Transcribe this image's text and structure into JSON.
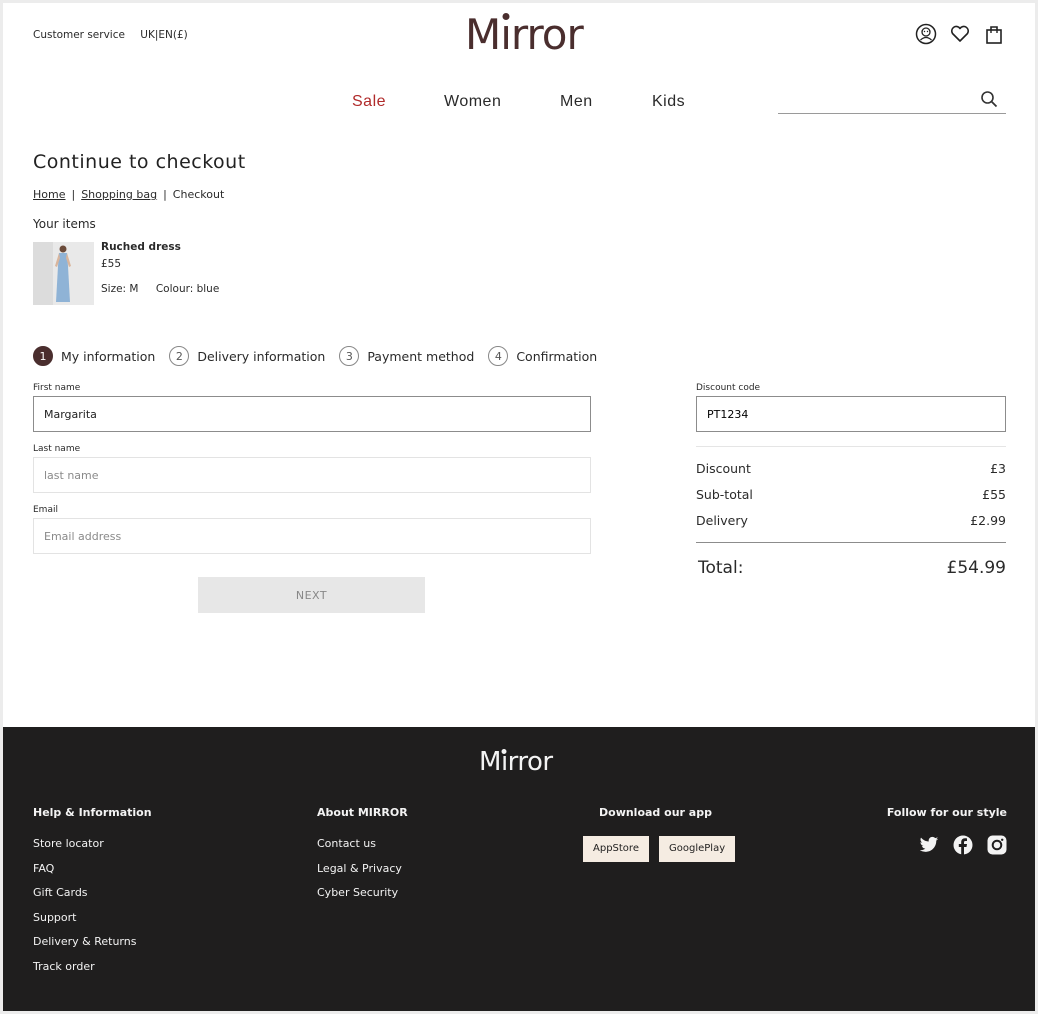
{
  "header": {
    "customer_service": "Customer service",
    "locale": "UK|EN(£)",
    "logo": "Mirror",
    "icons": [
      "account-icon",
      "heart-icon",
      "bag-icon"
    ]
  },
  "nav": {
    "items": [
      "Sale",
      "Women",
      "Men",
      "Kids"
    ],
    "search_placeholder": ""
  },
  "checkout": {
    "title": "Continue to checkout",
    "breadcrumb": [
      "Home",
      "Shopping bag",
      "Checkout"
    ],
    "your_items_label": "Your items",
    "item": {
      "name": "Ruched dress",
      "price": "£55",
      "size": "Size: M",
      "colour": "Colour: blue"
    },
    "steps": [
      {
        "num": "1",
        "label": "My information"
      },
      {
        "num": "2",
        "label": "Delivery information"
      },
      {
        "num": "3",
        "label": "Payment method"
      },
      {
        "num": "4",
        "label": "Confirmation"
      }
    ],
    "form": {
      "first_name_label": "First name",
      "first_name_value": "Margarita",
      "last_name_label": "Last name",
      "last_name_placeholder": "last name",
      "email_label": "Email",
      "email_placeholder": "Email address",
      "next_label": "NEXT"
    }
  },
  "summary": {
    "discount_code_label": "Discount code",
    "discount_code_value": "PT1234",
    "rows": [
      {
        "label": "Discount",
        "value": "£3"
      },
      {
        "label": "Sub-total",
        "value": "£55"
      },
      {
        "label": "Delivery",
        "value": "£2.99"
      }
    ],
    "total_label": "Total:",
    "total_value": "£54.99"
  },
  "footer": {
    "logo": "Mirror",
    "help_title": "Help & Information",
    "help_links": [
      "Store locator",
      "FAQ",
      "Gift Cards",
      "Support",
      "Delivery & Returns",
      "Track order"
    ],
    "about_title": "About MIRROR",
    "about_links": [
      "Contact us",
      "Legal & Privacy",
      "Cyber Security"
    ],
    "app_title": "Download our app",
    "app_buttons": [
      "AppStore",
      "GooglePlay"
    ],
    "follow_title": "Follow for our style",
    "social_icons": [
      "twitter-icon",
      "facebook-icon",
      "instagram-icon"
    ]
  },
  "colors": {
    "brand": "#4a2e2e",
    "sale": "#b02a2a",
    "footer_bg": "#1f1e1e",
    "store_button_bg": "#f5ece2"
  }
}
